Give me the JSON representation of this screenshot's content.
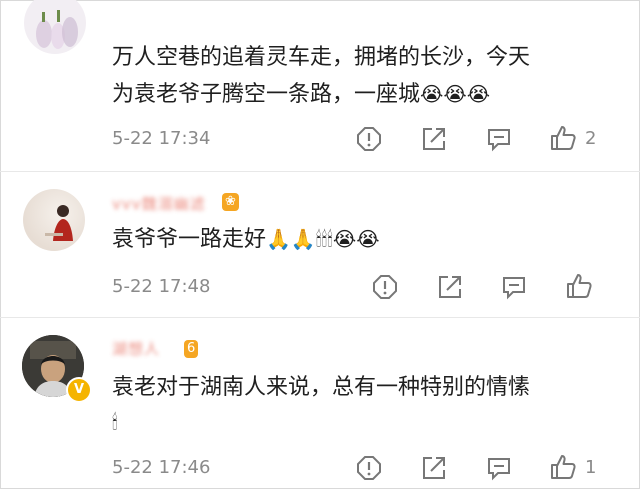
{
  "comments": [
    {
      "username": "",
      "line1": "万人空巷的追着灵车走，拥堵的长沙，今天",
      "line2_text": "为袁老爷子腾空一条路，一座城",
      "line2_emoji": "😭😭😭",
      "time": "5-22 17:34",
      "like_count": "2"
    },
    {
      "username": "vvv魏溺幽滤",
      "level": "❀",
      "line1_text": "袁爷爷一路走好",
      "line1_emoji": "🙏🙏🕯🕯🕯😭😭",
      "time": "5-22 17:48",
      "like_count": ""
    },
    {
      "username": "湖想人",
      "level": "6",
      "line1": "袁老对于湖南人来说，总有一种特别的情愫",
      "line2_emoji": "🕯",
      "time": "5-22 17:46",
      "like_count": "1"
    }
  ],
  "icons": {
    "report": "report-icon",
    "share": "share-icon",
    "comment": "comment-icon",
    "like": "like-icon"
  },
  "colors": {
    "text": "#1f1f1f",
    "meta": "#8a8a8a",
    "username": "#e8786a",
    "badge": "#f5b400"
  }
}
